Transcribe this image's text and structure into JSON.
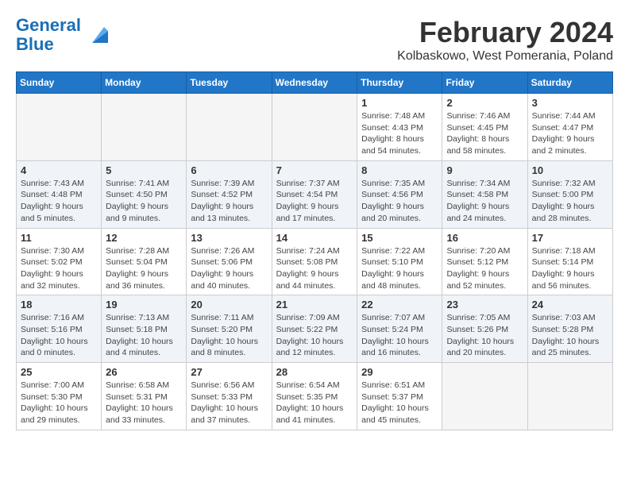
{
  "logo": {
    "line1": "General",
    "line2": "Blue"
  },
  "title": "February 2024",
  "subtitle": "Kolbaskowo, West Pomerania, Poland",
  "days_of_week": [
    "Sunday",
    "Monday",
    "Tuesday",
    "Wednesday",
    "Thursday",
    "Friday",
    "Saturday"
  ],
  "weeks": [
    [
      {
        "day": "",
        "info": ""
      },
      {
        "day": "",
        "info": ""
      },
      {
        "day": "",
        "info": ""
      },
      {
        "day": "",
        "info": ""
      },
      {
        "day": "1",
        "info": "Sunrise: 7:48 AM\nSunset: 4:43 PM\nDaylight: 8 hours\nand 54 minutes."
      },
      {
        "day": "2",
        "info": "Sunrise: 7:46 AM\nSunset: 4:45 PM\nDaylight: 8 hours\nand 58 minutes."
      },
      {
        "day": "3",
        "info": "Sunrise: 7:44 AM\nSunset: 4:47 PM\nDaylight: 9 hours\nand 2 minutes."
      }
    ],
    [
      {
        "day": "4",
        "info": "Sunrise: 7:43 AM\nSunset: 4:48 PM\nDaylight: 9 hours\nand 5 minutes."
      },
      {
        "day": "5",
        "info": "Sunrise: 7:41 AM\nSunset: 4:50 PM\nDaylight: 9 hours\nand 9 minutes."
      },
      {
        "day": "6",
        "info": "Sunrise: 7:39 AM\nSunset: 4:52 PM\nDaylight: 9 hours\nand 13 minutes."
      },
      {
        "day": "7",
        "info": "Sunrise: 7:37 AM\nSunset: 4:54 PM\nDaylight: 9 hours\nand 17 minutes."
      },
      {
        "day": "8",
        "info": "Sunrise: 7:35 AM\nSunset: 4:56 PM\nDaylight: 9 hours\nand 20 minutes."
      },
      {
        "day": "9",
        "info": "Sunrise: 7:34 AM\nSunset: 4:58 PM\nDaylight: 9 hours\nand 24 minutes."
      },
      {
        "day": "10",
        "info": "Sunrise: 7:32 AM\nSunset: 5:00 PM\nDaylight: 9 hours\nand 28 minutes."
      }
    ],
    [
      {
        "day": "11",
        "info": "Sunrise: 7:30 AM\nSunset: 5:02 PM\nDaylight: 9 hours\nand 32 minutes."
      },
      {
        "day": "12",
        "info": "Sunrise: 7:28 AM\nSunset: 5:04 PM\nDaylight: 9 hours\nand 36 minutes."
      },
      {
        "day": "13",
        "info": "Sunrise: 7:26 AM\nSunset: 5:06 PM\nDaylight: 9 hours\nand 40 minutes."
      },
      {
        "day": "14",
        "info": "Sunrise: 7:24 AM\nSunset: 5:08 PM\nDaylight: 9 hours\nand 44 minutes."
      },
      {
        "day": "15",
        "info": "Sunrise: 7:22 AM\nSunset: 5:10 PM\nDaylight: 9 hours\nand 48 minutes."
      },
      {
        "day": "16",
        "info": "Sunrise: 7:20 AM\nSunset: 5:12 PM\nDaylight: 9 hours\nand 52 minutes."
      },
      {
        "day": "17",
        "info": "Sunrise: 7:18 AM\nSunset: 5:14 PM\nDaylight: 9 hours\nand 56 minutes."
      }
    ],
    [
      {
        "day": "18",
        "info": "Sunrise: 7:16 AM\nSunset: 5:16 PM\nDaylight: 10 hours\nand 0 minutes."
      },
      {
        "day": "19",
        "info": "Sunrise: 7:13 AM\nSunset: 5:18 PM\nDaylight: 10 hours\nand 4 minutes."
      },
      {
        "day": "20",
        "info": "Sunrise: 7:11 AM\nSunset: 5:20 PM\nDaylight: 10 hours\nand 8 minutes."
      },
      {
        "day": "21",
        "info": "Sunrise: 7:09 AM\nSunset: 5:22 PM\nDaylight: 10 hours\nand 12 minutes."
      },
      {
        "day": "22",
        "info": "Sunrise: 7:07 AM\nSunset: 5:24 PM\nDaylight: 10 hours\nand 16 minutes."
      },
      {
        "day": "23",
        "info": "Sunrise: 7:05 AM\nSunset: 5:26 PM\nDaylight: 10 hours\nand 20 minutes."
      },
      {
        "day": "24",
        "info": "Sunrise: 7:03 AM\nSunset: 5:28 PM\nDaylight: 10 hours\nand 25 minutes."
      }
    ],
    [
      {
        "day": "25",
        "info": "Sunrise: 7:00 AM\nSunset: 5:30 PM\nDaylight: 10 hours\nand 29 minutes."
      },
      {
        "day": "26",
        "info": "Sunrise: 6:58 AM\nSunset: 5:31 PM\nDaylight: 10 hours\nand 33 minutes."
      },
      {
        "day": "27",
        "info": "Sunrise: 6:56 AM\nSunset: 5:33 PM\nDaylight: 10 hours\nand 37 minutes."
      },
      {
        "day": "28",
        "info": "Sunrise: 6:54 AM\nSunset: 5:35 PM\nDaylight: 10 hours\nand 41 minutes."
      },
      {
        "day": "29",
        "info": "Sunrise: 6:51 AM\nSunset: 5:37 PM\nDaylight: 10 hours\nand 45 minutes."
      },
      {
        "day": "",
        "info": ""
      },
      {
        "day": "",
        "info": ""
      }
    ]
  ]
}
